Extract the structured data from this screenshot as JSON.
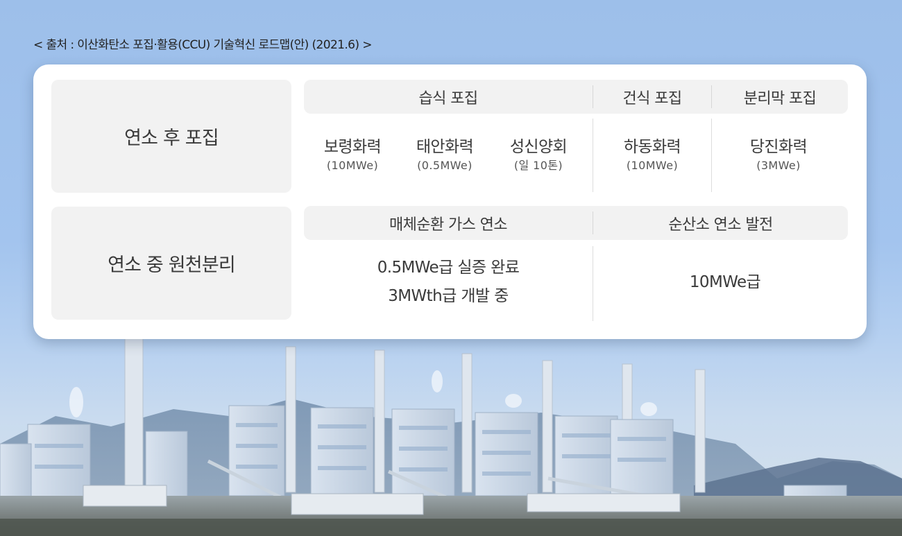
{
  "source_caption": "< 출처 : 이산화탄소 포집·활용(CCU) 기술혁신 로드맵(안) (2021.6) >",
  "table": {
    "rows": [
      {
        "category": "연소 후 포집",
        "groups": [
          {
            "header": "습식 포집",
            "sites": [
              {
                "name": "보령화력",
                "scale": "(10MWe)"
              },
              {
                "name": "태안화력",
                "scale": "(0.5MWe)"
              },
              {
                "name": "성신양회",
                "scale": "(일 10톤)"
              }
            ]
          },
          {
            "header": "건식 포집",
            "sites": [
              {
                "name": "하동화력",
                "scale": "(10MWe)"
              }
            ]
          },
          {
            "header": "분리막 포집",
            "sites": [
              {
                "name": "당진화력",
                "scale": "(3MWe)"
              }
            ]
          }
        ]
      },
      {
        "category": "연소 중 원천분리",
        "groups": [
          {
            "header": "매체순환 가스 연소",
            "status": [
              "0.5MWe급 실증 완료",
              "3MWth급 개발 중"
            ]
          },
          {
            "header": "순산소 연소 발전",
            "status": [
              "10MWe급"
            ]
          }
        ]
      }
    ]
  },
  "colors": {
    "sky": "#9dbfea",
    "card": "#ffffff",
    "cell_fill": "#f2f2f2",
    "text": "#3a3a3a"
  }
}
